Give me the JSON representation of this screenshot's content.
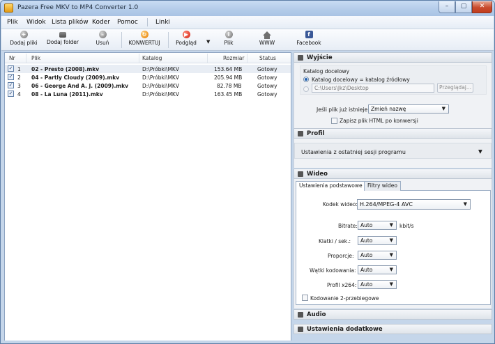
{
  "window": {
    "title": "Pazera Free MKV to MP4 Converter 1.0",
    "min": "–",
    "max": "▢",
    "close": "✕"
  },
  "menu": [
    "Plik",
    "Widok",
    "Lista plików",
    "Koder",
    "Pomoc",
    "Linki"
  ],
  "toolbar": {
    "add_files": "Dodaj pliki",
    "add_folder": "Dodaj folder",
    "remove": "Usuń",
    "convert": "KONWERTUJ",
    "preview": "Podgląd",
    "file": "Plik",
    "www": "WWW",
    "facebook": "Facebook",
    "dropdown": "▼"
  },
  "list": {
    "columns": {
      "nr": "Nr",
      "file": "Plik",
      "dir": "Katalog",
      "size": "Rozmiar",
      "status": "Status"
    },
    "rows": [
      {
        "checked": "✓",
        "nr": "1",
        "file": "02 - Presto (2008).mkv",
        "dir": "D:\\Próbki\\MKV",
        "size": "153.64 MB",
        "status": "Gotowy"
      },
      {
        "checked": "✓",
        "nr": "2",
        "file": "04 - Partly Cloudy (2009).mkv",
        "dir": "D:\\Próbki\\MKV",
        "size": "205.94 MB",
        "status": "Gotowy"
      },
      {
        "checked": "✓",
        "nr": "3",
        "file": "06 - George And A. J. (2009).mkv",
        "dir": "D:\\Próbki\\MKV",
        "size": "82.78 MB",
        "status": "Gotowy"
      },
      {
        "checked": "✓",
        "nr": "4",
        "file": "08 - La Luna (2011).mkv",
        "dir": "D:\\Próbki\\MKV",
        "size": "163.45 MB",
        "status": "Gotowy"
      }
    ]
  },
  "output": {
    "title": "Wyjście",
    "group_label": "Katalog docelowy",
    "radio_same": "Katalog docelowy = katalog źródłowy",
    "path": "C:\\Users\\Jkz\\Desktop",
    "browse": "Przeglądaj...",
    "exists_label": "Jeśli plik już istnieje:",
    "exists_value": "Zmień nazwę",
    "save_html": "Zapisz plik HTML po konwersji"
  },
  "profile": {
    "title": "Profil",
    "value": "Ustawienia z ostatniej sesji programu",
    "arrow": "▼"
  },
  "video": {
    "title": "Wideo",
    "tab_basic": "Ustawienia podstawowe",
    "tab_filters": "Filtry wideo",
    "codec_label": "Kodek wideo:",
    "codec_value": "H.264/MPEG-4 AVC",
    "bitrate_label": "Bitrate:",
    "bitrate_value": "Auto",
    "bitrate_unit": "kbit/s",
    "fps_label": "Klatki / sek.:",
    "fps_value": "Auto",
    "aspect_label": "Proporcje:",
    "aspect_value": "Auto",
    "threads_label": "Wątki kodowania:",
    "threads_value": "Auto",
    "profile_label": "Profil x264:",
    "profile_value": "Auto",
    "two_pass": "Kodowanie 2-przebiegowe"
  },
  "audio": {
    "title": "Audio"
  },
  "extra": {
    "title": "Ustawienia dodatkowe"
  }
}
